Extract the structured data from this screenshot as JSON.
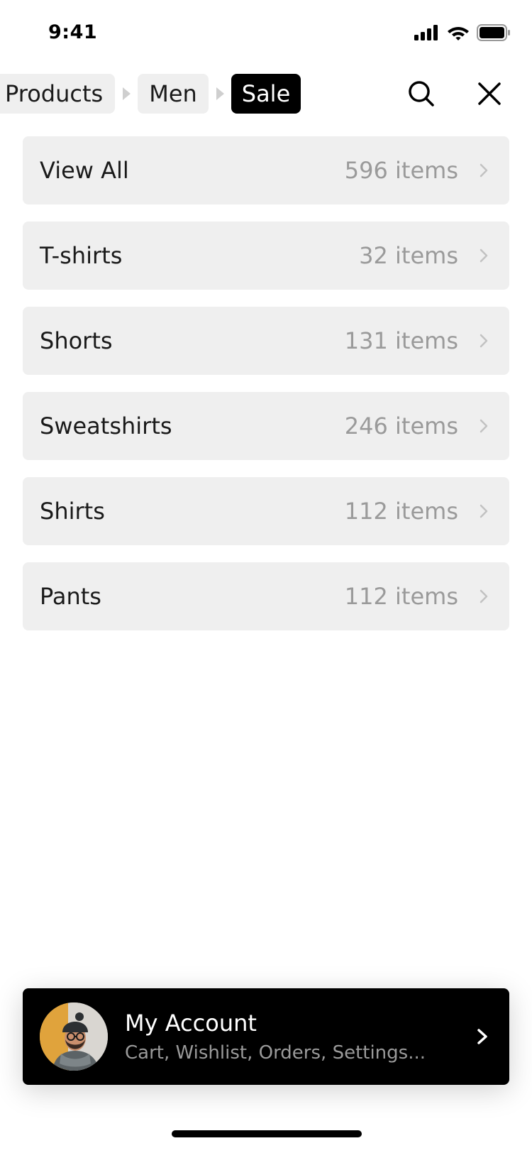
{
  "status_bar": {
    "time": "9:41"
  },
  "breadcrumb": {
    "items": [
      {
        "label": "Products",
        "active": false
      },
      {
        "label": "Men",
        "active": false
      },
      {
        "label": "Sale",
        "active": true
      }
    ]
  },
  "categories": [
    {
      "label": "View All",
      "count": "596 items"
    },
    {
      "label": "T-shirts",
      "count": "32 items"
    },
    {
      "label": "Shorts",
      "count": "131 items"
    },
    {
      "label": "Sweatshirts",
      "count": "246 items"
    },
    {
      "label": "Shirts",
      "count": "112 items"
    },
    {
      "label": "Pants",
      "count": "112 items"
    }
  ],
  "account": {
    "title": "My Account",
    "subtitle": "Cart, Wishlist, Orders, Settings..."
  },
  "colors": {
    "accent": "#000000",
    "row_background": "#efefef",
    "muted_text": "#9a9a9a"
  }
}
